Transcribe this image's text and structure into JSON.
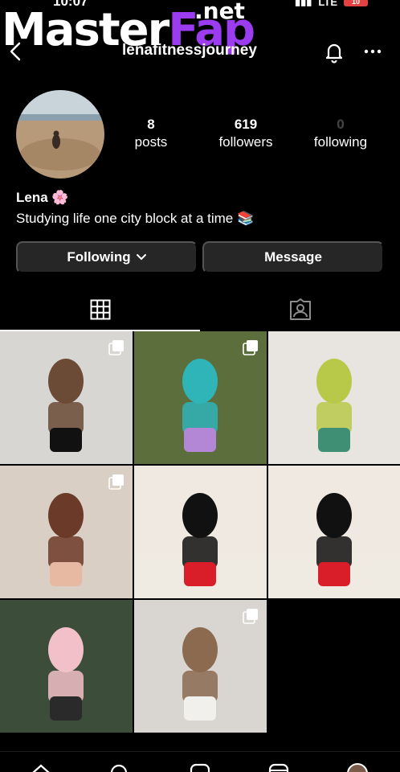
{
  "status": {
    "time": "10:07",
    "network": "LTE",
    "battery": "10"
  },
  "watermark": {
    "part_a": "Master",
    "part_b": "Fap",
    "part_c": ".net"
  },
  "profile": {
    "username": "lenafitnessjourney",
    "posts_count": "8",
    "posts_label": "posts",
    "followers_count": "619",
    "followers_label": "followers",
    "following_count": "0",
    "following_label": "following",
    "name": "Lena 🌸",
    "bio": "Studying life one city block at a time 📚"
  },
  "actions": {
    "following_label": "Following",
    "message_label": "Message"
  },
  "tabs": [
    {
      "name": "grid",
      "icon": "grid-icon",
      "active": true
    },
    {
      "name": "tagged",
      "icon": "tagged-icon",
      "active": false
    }
  ],
  "posts": [
    {
      "name": "post-1",
      "multi": true,
      "colors": [
        "#d8d6d2",
        "#6b4a36",
        "#111111"
      ]
    },
    {
      "name": "post-2",
      "multi": true,
      "colors": [
        "#5c6e3c",
        "#2fb4b8",
        "#b487d6"
      ]
    },
    {
      "name": "post-3",
      "multi": false,
      "colors": [
        "#e8e4df",
        "#b8c94a",
        "#3f8f74"
      ]
    },
    {
      "name": "post-4",
      "multi": true,
      "colors": [
        "#d9cfc4",
        "#6c3a28",
        "#e8b9a2"
      ]
    },
    {
      "name": "post-5",
      "multi": false,
      "colors": [
        "#efe9e2",
        "#111111",
        "#d91e2a"
      ]
    },
    {
      "name": "post-6",
      "multi": false,
      "colors": [
        "#efe9e2",
        "#111111",
        "#d91e2a"
      ]
    },
    {
      "name": "post-7",
      "multi": false,
      "colors": [
        "#3c4d3a",
        "#f2c0c8",
        "#2a2a2a"
      ]
    },
    {
      "name": "post-8",
      "multi": true,
      "colors": [
        "#d9d6d2",
        "#8b6a50",
        "#f2f0ec"
      ]
    }
  ],
  "bottom_nav": [
    "home-icon",
    "search-icon",
    "create-icon",
    "reels-icon",
    "profile-avatar"
  ]
}
